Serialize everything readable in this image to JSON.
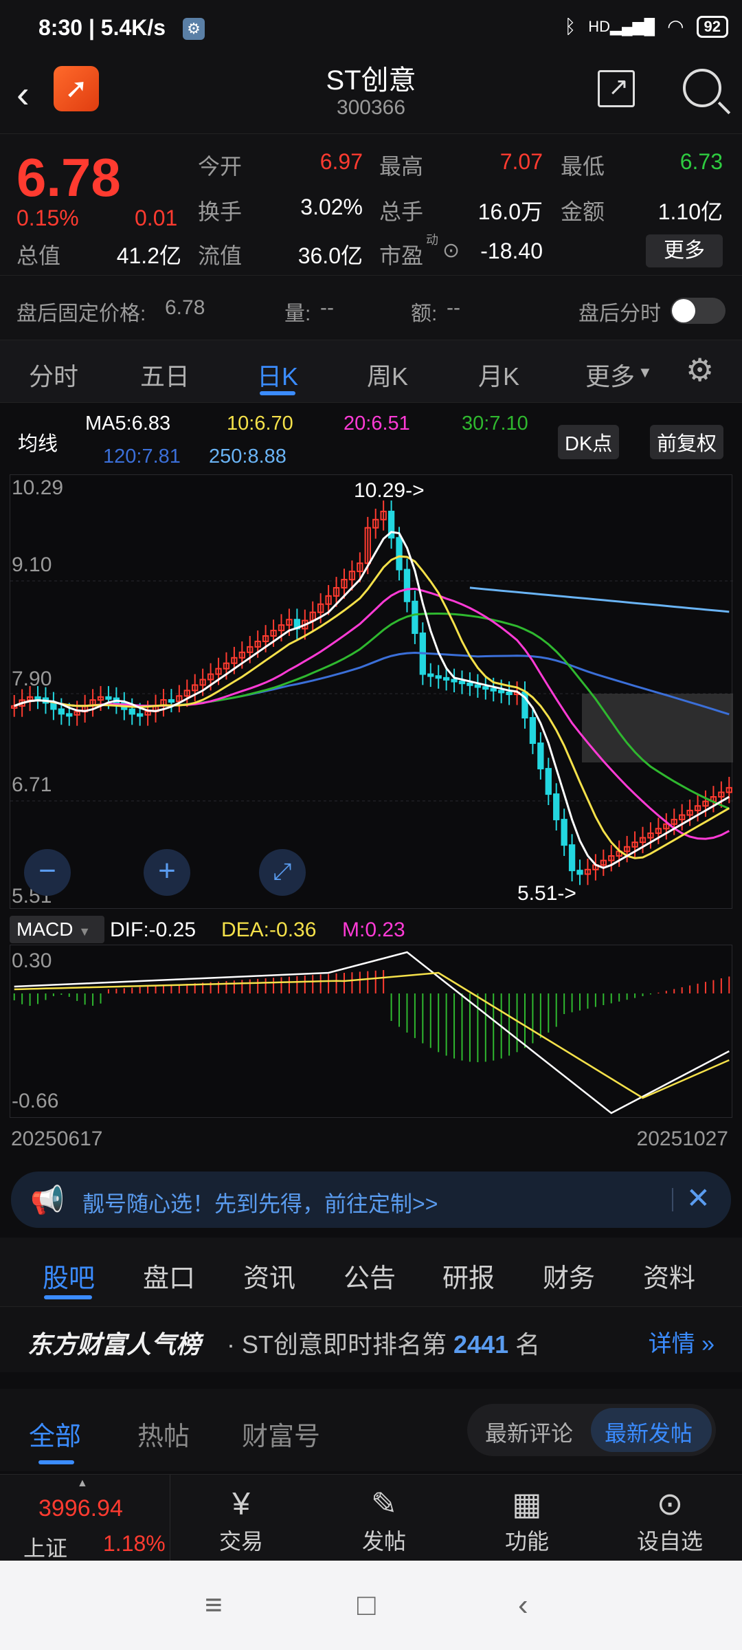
{
  "status": {
    "time": "8:30 | 5.4K/s",
    "battery": "92",
    "network": "HD"
  },
  "header": {
    "name": "ST创意",
    "code": "300366"
  },
  "quote": {
    "price": "6.78",
    "pct": "0.15%",
    "change": "0.01",
    "stats": [
      {
        "label": "今开",
        "value": "6.97",
        "color": "red"
      },
      {
        "label": "最高",
        "value": "7.07",
        "color": "red"
      },
      {
        "label": "最低",
        "value": "6.73",
        "color": "green"
      },
      {
        "label": "换手",
        "value": "3.02%",
        "color": "white"
      },
      {
        "label": "总手",
        "value": "16.0万",
        "color": "white"
      },
      {
        "label": "金额",
        "value": "1.10亿",
        "color": "white"
      },
      {
        "label": "总值",
        "value": "41.2亿",
        "color": "white"
      },
      {
        "label": "流值",
        "value": "36.0亿",
        "color": "white"
      },
      {
        "label": "市盈",
        "value": "-18.40",
        "color": "white",
        "superscript": "动"
      }
    ],
    "more_label": "更多"
  },
  "after_hours": {
    "label": "盘后固定价格:",
    "price": "6.78",
    "vol_label": "量:",
    "vol": "--",
    "amt_label": "额:",
    "amt": "--",
    "timeshare_label": "盘后分时"
  },
  "chart_tabs": [
    "分时",
    "五日",
    "日K",
    "周K",
    "月K",
    "更多"
  ],
  "ma": {
    "title": "均线",
    "ma5": "MA5:6.83",
    "ma10": "10:6.70",
    "ma20": "20:6.51",
    "ma30": "30:7.10",
    "ma120": "120:7.81",
    "ma250": "250:8.88",
    "dk_label": "DK点",
    "adjust_label": "前复权"
  },
  "kline_labels": {
    "y_top": "10.29",
    "y2": "9.10",
    "y3": "7.90",
    "y4": "6.71",
    "y_bottom": "5.51",
    "high_note": "10.29->",
    "low_note": "5.51->"
  },
  "macd": {
    "label": "MACD",
    "dif": "DIF:-0.25",
    "dea": "DEA:-0.36",
    "m": "M:0.23",
    "y_top": "0.30",
    "y_bottom": "-0.66"
  },
  "dates": {
    "start": "20250617",
    "end": "20251027"
  },
  "banner": {
    "text": "靓号随心选！先到先得，前往定制>>"
  },
  "info_tabs": [
    "股吧",
    "盘口",
    "资讯",
    "公告",
    "研报",
    "财务",
    "资料"
  ],
  "rank": {
    "brand": "东方财富人气榜",
    "prefix": "· ST创意即时排名第 ",
    "number": "2441",
    "suffix": " 名",
    "detail": "详情"
  },
  "post_tabs": [
    "全部",
    "热帖",
    "财富号"
  ],
  "sort": {
    "option1": "最新评论",
    "option2": "最新发帖"
  },
  "index": {
    "value": "3996.94",
    "name": "上证",
    "pct": "1.18%"
  },
  "bottom_nav": [
    {
      "label": "交易",
      "icon": "trade-icon"
    },
    {
      "label": "发帖",
      "icon": "post-icon"
    },
    {
      "label": "功能",
      "icon": "grid-icon"
    },
    {
      "label": "设自选",
      "icon": "more-icon"
    }
  ],
  "colors": {
    "up": "#ff3b30",
    "down": "#2ecc40",
    "accent": "#3b8cff",
    "ma5": "#ffffff",
    "ma10": "#f5e14a",
    "ma20": "#ff3bd6",
    "ma30": "#2fb82f",
    "ma120": "#3b6fd8",
    "ma250": "#6ab4f5"
  }
}
